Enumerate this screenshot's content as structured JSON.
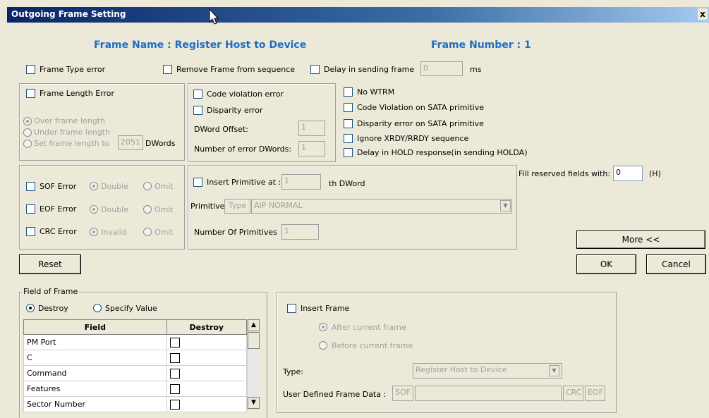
{
  "window": {
    "title": "Outgoing Frame Setting",
    "close_glyph": "x"
  },
  "header": {
    "frame_name": "Frame Name : Register Host to Device",
    "frame_number": "Frame Number : 1"
  },
  "top_row": {
    "frame_type_error": "Frame Type error",
    "remove_frame": "Remove Frame from sequence",
    "delay_in_sending": "Delay in sending frame",
    "delay_value": "0",
    "delay_unit": "ms"
  },
  "length_group": {
    "frame_length_error": "Frame Length Error",
    "over": "Over frame length",
    "under": "Under frame length",
    "set_to": "Set frame length to",
    "set_value": "2051",
    "dwords": "DWords"
  },
  "code_group": {
    "code_violation": "Code violation error",
    "disparity": "Disparity error",
    "dword_offset_label": "DWord Offset:",
    "dword_offset_value": "1",
    "num_error_label": "Number of error DWords:",
    "num_error_value": "1"
  },
  "right_checks": {
    "no_wtrm": "No WTRM",
    "code_violation_sata": "Code Violation on SATA primitive",
    "disparity_sata": "Disparity error on SATA primitive",
    "ignore_xrdy": "Ignore XRDY/RRDY sequence",
    "delay_hold": "Delay in HOLD response(in sending HOLDA)"
  },
  "sof_group": {
    "sof_error": "SOF Error",
    "eof_error": "EOF Error",
    "crc_error": "CRC Error",
    "double": "Double",
    "omit": "Omit",
    "invalid": "Invalid"
  },
  "primitive_group": {
    "insert_primitive_at": "Insert Primitive at :",
    "insert_value": "1",
    "th_dword": "th  DWord",
    "primitive_label": "Primitive:",
    "type_button": "Type",
    "primitive_value": "AIP NORMAL",
    "num_primitives_label": "Number Of Primitives",
    "num_primitives_value": "1"
  },
  "fill_reserved": {
    "label": "Fill reserved fields with:",
    "value": "0",
    "unit": "(H)"
  },
  "buttons": {
    "more": "More <<",
    "ok": "OK",
    "cancel": "Cancel",
    "reset": "Reset"
  },
  "field_of_frame": {
    "title": "Field of Frame",
    "destroy_radio": "Destroy",
    "specify_value": "Specify Value",
    "columns": [
      "Field",
      "Destroy"
    ],
    "rows": [
      {
        "field": "PM Port"
      },
      {
        "field": "C"
      },
      {
        "field": "Command"
      },
      {
        "field": "Features"
      },
      {
        "field": "Sector Number"
      }
    ]
  },
  "insert_frame": {
    "insert_label": "Insert Frame",
    "after": "After current frame",
    "before": "Before current frame",
    "type_label": "Type:",
    "type_value": "Register Host to Device",
    "udf_label": "User Defined Frame Data :",
    "sof": "SOF",
    "crc": "CRC",
    "eof": "EOF"
  }
}
